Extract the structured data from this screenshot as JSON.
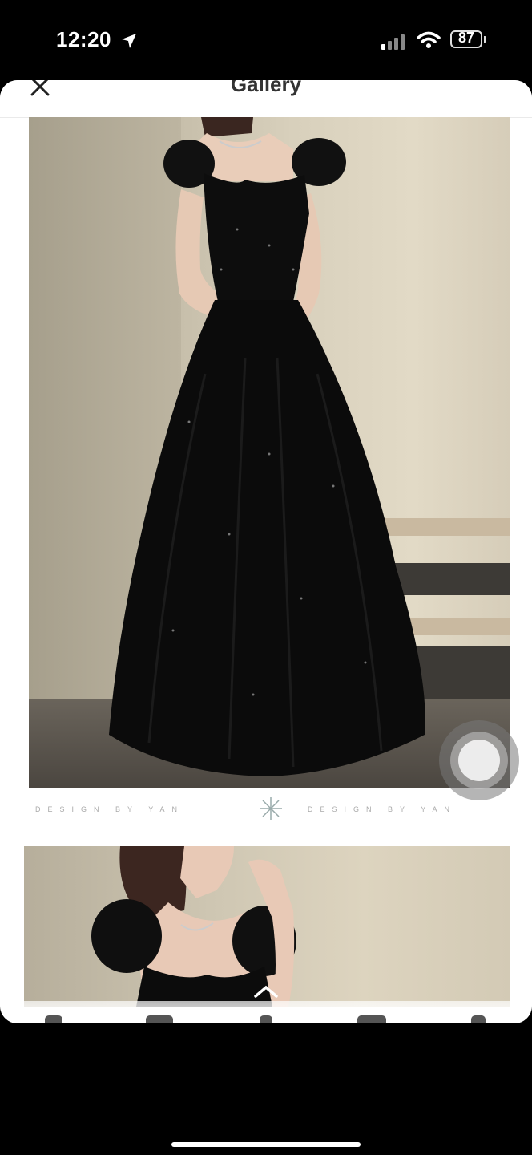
{
  "status_bar": {
    "time": "12:20",
    "battery": "87"
  },
  "header": {
    "title": "Gallery"
  },
  "gallery": {
    "caption_left": "DESIGN BY YAN",
    "caption_right": "DESIGN BY YAN"
  },
  "icons": {
    "close": "close-icon",
    "snowflake": "snowflake-icon",
    "chevron": "chevron-up-icon",
    "assistive_touch": "assistive-touch-button"
  },
  "colors": {
    "dress": "#0b0b0b",
    "wall": "#d3cab6",
    "background": "#000000"
  }
}
